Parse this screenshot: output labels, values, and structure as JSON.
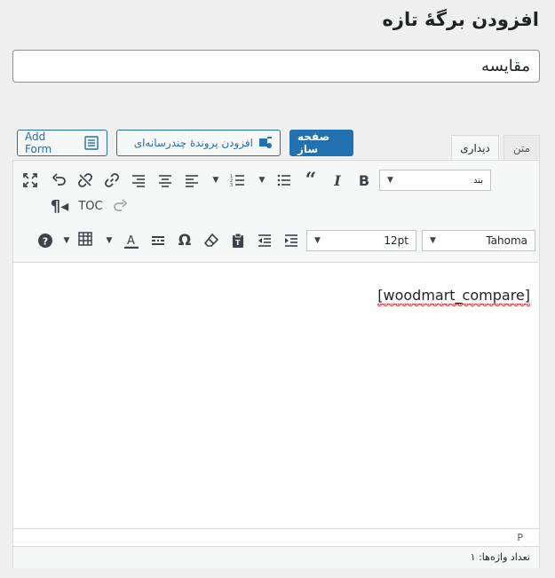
{
  "page": {
    "title": "افزودن برگهٔ تازه"
  },
  "title_input": {
    "value": "مقایسه"
  },
  "buttons": {
    "add_form": "Add Form",
    "add_media": "افزودن پروندهٔ چندرسانه‌ای",
    "page_builder": "صفحه ساز"
  },
  "tabs": {
    "text": "متن",
    "visual": "دیداری"
  },
  "toolbar": {
    "row1": {
      "format_select": "بند",
      "icons": [
        "bold-icon",
        "italic-icon",
        "blockquote-icon",
        "bullet-list-icon",
        "numbered-list-icon",
        "align-left-icon",
        "align-center-icon",
        "align-right-icon",
        "link-icon",
        "unlink-icon",
        "undo-icon",
        "fullscreen-icon"
      ]
    },
    "row2": {
      "toc_label": "TOC",
      "icons": [
        "paragraph-mark-icon",
        "redo-icon"
      ]
    },
    "row3": {
      "font_family": "Tahoma",
      "font_size": "12pt",
      "icons": [
        "indent-icon",
        "outdent-icon",
        "paste-text-icon",
        "clear-formatting-icon",
        "special-char-icon",
        "horizontal-line-icon",
        "text-color-icon",
        "table-icon",
        "help-icon"
      ]
    }
  },
  "editor": {
    "content": "[woodmart_compare]",
    "path": "P",
    "word_count": "تعداد واژه‌ها: ۱"
  },
  "colors": {
    "primary": "#2271b1",
    "background": "#f0f0f1",
    "toolbar_bg": "#f6f7f7"
  }
}
